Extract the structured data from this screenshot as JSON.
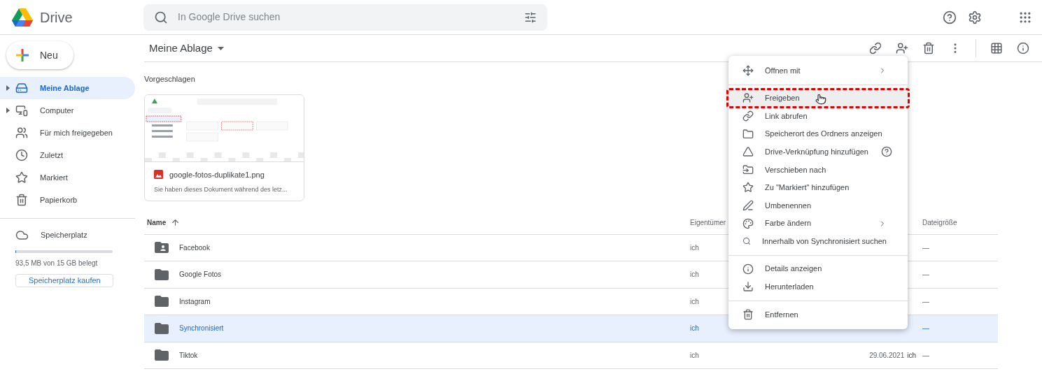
{
  "header": {
    "app_name": "Drive",
    "search": {
      "placeholder": "In Google Drive suchen"
    }
  },
  "sidebar": {
    "new_button": "Neu",
    "items": [
      {
        "label": "Meine Ablage",
        "selected": true,
        "expandable": true
      },
      {
        "label": "Computer",
        "selected": false,
        "expandable": true
      },
      {
        "label": "Für mich freigegeben",
        "selected": false,
        "expandable": false
      },
      {
        "label": "Zuletzt",
        "selected": false,
        "expandable": false
      },
      {
        "label": "Markiert",
        "selected": false,
        "expandable": false
      },
      {
        "label": "Papierkorb",
        "selected": false,
        "expandable": false
      }
    ],
    "storage": {
      "label": "Speicherplatz",
      "level": 0.01,
      "usage": "93,5 MB von 15 GB belegt",
      "buy_button": "Speicherplatz kaufen"
    }
  },
  "toolbar": {
    "title": "Meine Ablage"
  },
  "suggested": {
    "heading": "Vorgeschlagen",
    "cards": [
      {
        "file_name": "google-fotos-duplikate1.png",
        "description": "Sie haben dieses Dokument während des letz..."
      }
    ]
  },
  "table": {
    "columns": [
      {
        "label": "Name",
        "sorted": true
      },
      {
        "label": "Eigentümer",
        "sorted": false
      },
      {
        "label": "Dateigröße",
        "sorted": false
      }
    ],
    "rows": [
      {
        "kind": "shared_folder",
        "name": "Facebook",
        "owner": "ich",
        "size": "—",
        "selected": false
      },
      {
        "kind": "folder",
        "name": "Google Fotos",
        "owner": "ich",
        "size": "—",
        "selected": false
      },
      {
        "kind": "folder",
        "name": "Instagram",
        "owner": "ich",
        "size": "—",
        "selected": false
      },
      {
        "kind": "folder",
        "name": "Synchronisiert",
        "owner": "ich",
        "size": "—",
        "selected": true
      },
      {
        "kind": "folder",
        "name": "Tiktok",
        "owner": "ich",
        "modified": {
          "date": "29.06.2021",
          "by": "ich"
        },
        "size": "—",
        "selected": false
      }
    ]
  },
  "context_menu": {
    "groups": [
      [
        {
          "label": "Öffnen mit",
          "submenu": true,
          "selected": false,
          "marked": false,
          "help": false
        }
      ],
      [
        {
          "label": "Freigeben",
          "submenu": false,
          "selected": true,
          "marked": true,
          "help": false
        },
        {
          "label": "Link abrufen",
          "submenu": false,
          "selected": false,
          "marked": false,
          "help": false
        },
        {
          "label": "Speicherort des Ordners anzeigen",
          "submenu": false,
          "selected": false,
          "marked": false,
          "help": false
        },
        {
          "label": "Drive-Verknüpfung hinzufügen",
          "submenu": false,
          "selected": false,
          "marked": false,
          "help": true
        },
        {
          "label": "Verschieben nach",
          "submenu": false,
          "selected": false,
          "marked": false,
          "help": false
        },
        {
          "label": "Zu \"Markiert\" hinzufügen",
          "submenu": false,
          "selected": false,
          "marked": false,
          "help": false
        },
        {
          "label": "Umbenennen",
          "submenu": false,
          "selected": false,
          "marked": false,
          "help": false
        },
        {
          "label": "Farbe ändern",
          "submenu": true,
          "selected": false,
          "marked": false,
          "help": false
        },
        {
          "label": "Innerhalb von Synchronisiert suchen",
          "submenu": false,
          "selected": false,
          "marked": false,
          "help": false
        }
      ],
      [
        {
          "label": "Details anzeigen",
          "submenu": false,
          "selected": false,
          "marked": false,
          "help": false
        },
        {
          "label": "Herunterladen",
          "submenu": false,
          "selected": false,
          "marked": false,
          "help": false
        }
      ],
      [
        {
          "label": "Entfernen",
          "submenu": false,
          "selected": false,
          "marked": false,
          "help": false
        }
      ]
    ]
  }
}
